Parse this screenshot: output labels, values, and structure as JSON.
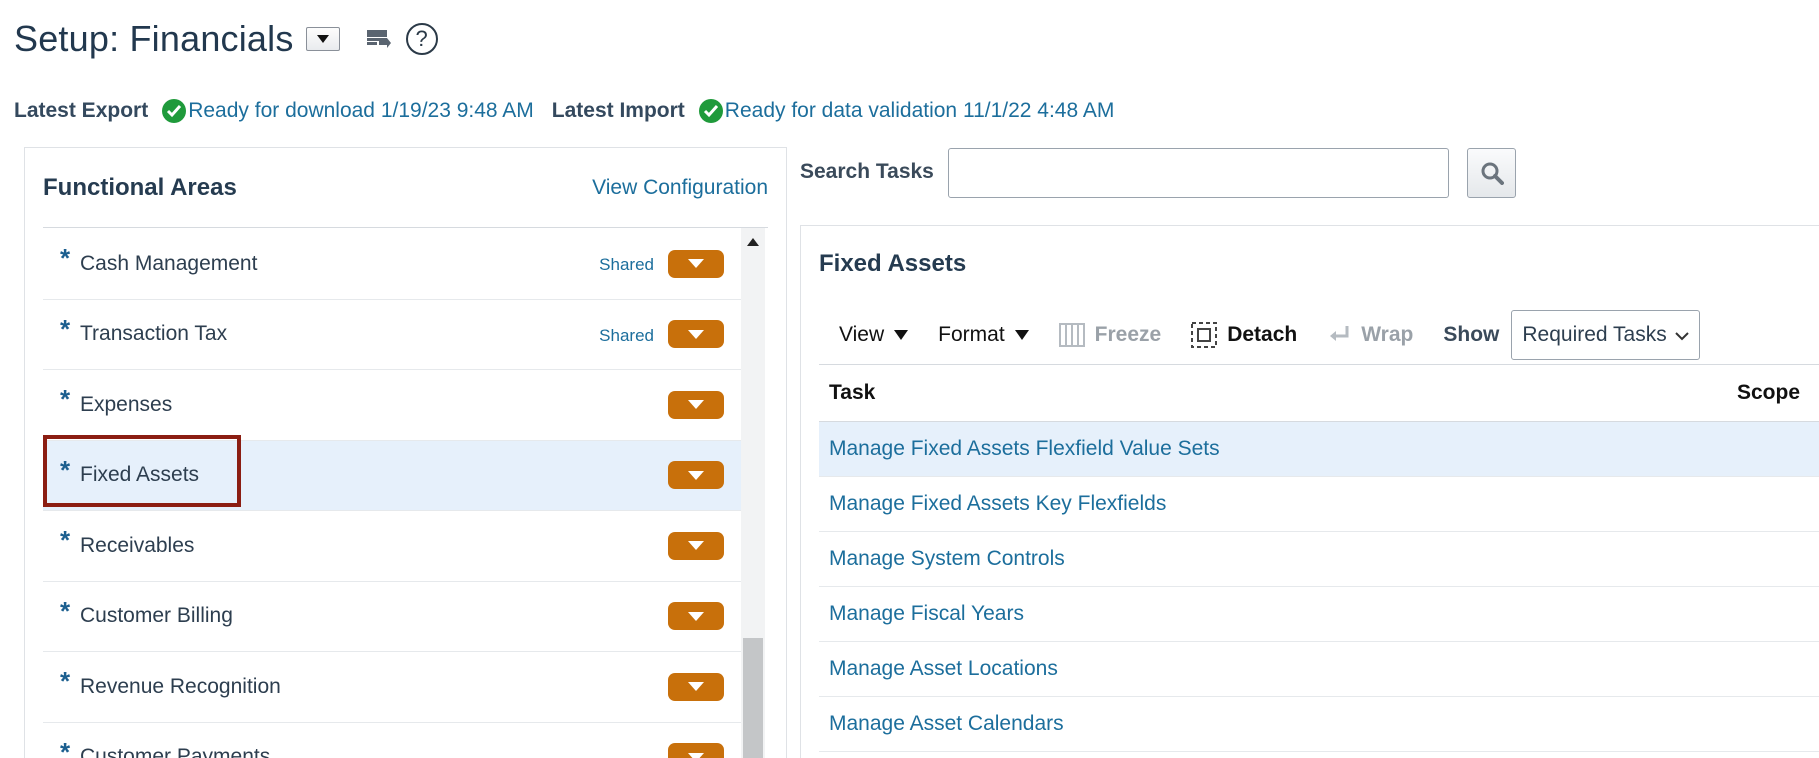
{
  "header": {
    "title": "Setup: Financials",
    "help_glyph": "?"
  },
  "status": {
    "export_label": "Latest Export",
    "export_text": "Ready for download 1/19/23 9:48 AM",
    "import_label": "Latest Import",
    "import_text": "Ready for data validation 11/1/22 4:48 AM",
    "check_color": "#1f9a3b"
  },
  "functional_areas": {
    "title": "Functional Areas",
    "view_configuration": "View Configuration",
    "items": [
      {
        "label": "Cash Management",
        "shared": "Shared"
      },
      {
        "label": "Transaction Tax",
        "shared": "Shared"
      },
      {
        "label": "Expenses",
        "shared": ""
      },
      {
        "label": "Fixed Assets",
        "shared": "",
        "selected": true
      },
      {
        "label": "Receivables",
        "shared": ""
      },
      {
        "label": "Customer Billing",
        "shared": ""
      },
      {
        "label": "Revenue Recognition",
        "shared": ""
      },
      {
        "label": "Customer Payments",
        "shared": ""
      }
    ],
    "required_marker": "*",
    "button_color": "#c8700b"
  },
  "search": {
    "label": "Search Tasks",
    "value": ""
  },
  "tasks_panel": {
    "title": "Fixed Assets",
    "toolbar": {
      "view": "View",
      "format": "Format",
      "freeze": "Freeze",
      "detach": "Detach",
      "wrap": "Wrap",
      "show_label": "Show",
      "show_value": "Required Tasks"
    },
    "columns": {
      "task": "Task",
      "scope": "Scope"
    },
    "rows": [
      "Manage Fixed Assets Flexfield Value Sets",
      "Manage Fixed Assets Key Flexfields",
      "Manage System Controls",
      "Manage Fiscal Years",
      "Manage Asset Locations",
      "Manage Asset Calendars"
    ]
  }
}
